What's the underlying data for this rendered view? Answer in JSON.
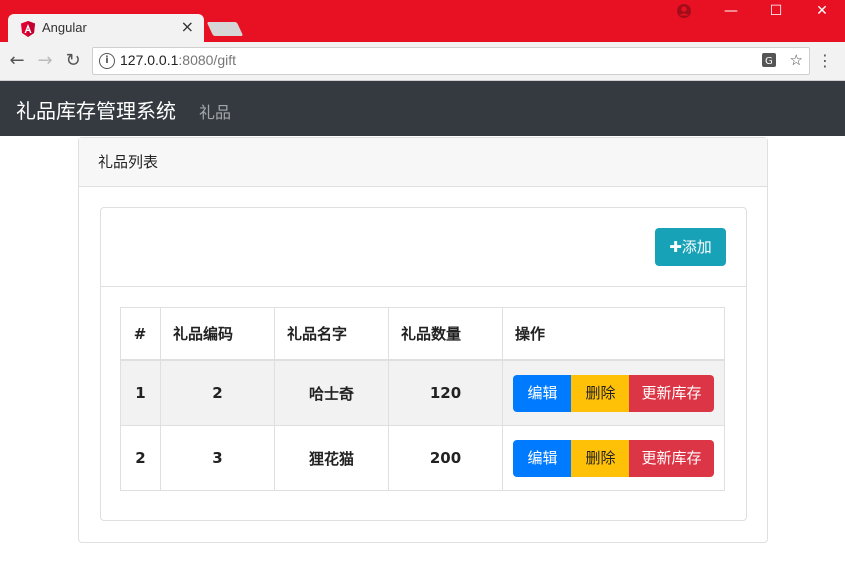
{
  "browser": {
    "tab_title": "Angular",
    "tab_close": "×",
    "url_host": "127.0.0.1",
    "url_path": ":8080/gift",
    "win_minimize": "—",
    "win_maximize": "☐",
    "win_close": "✕"
  },
  "app": {
    "brand": "礼品库存管理系统",
    "nav_gift": "礼品"
  },
  "card": {
    "title": "礼品列表",
    "add_label": "添加",
    "add_icon": "✚"
  },
  "table": {
    "headers": [
      "#",
      "礼品编码",
      "礼品名字",
      "礼品数量",
      "操作"
    ],
    "rows": [
      {
        "index": "1",
        "code": "2",
        "name": "哈士奇",
        "qty": "120"
      },
      {
        "index": "2",
        "code": "3",
        "name": "狸花猫",
        "qty": "200"
      }
    ],
    "actions": {
      "edit": "编辑",
      "delete": "删除",
      "update": "更新库存"
    }
  },
  "colors": {
    "titlebar": "#e81123",
    "navbar": "#343a40",
    "add": "#17a2b8",
    "edit": "#007bff",
    "delete": "#ffc107",
    "update": "#dc3545"
  }
}
